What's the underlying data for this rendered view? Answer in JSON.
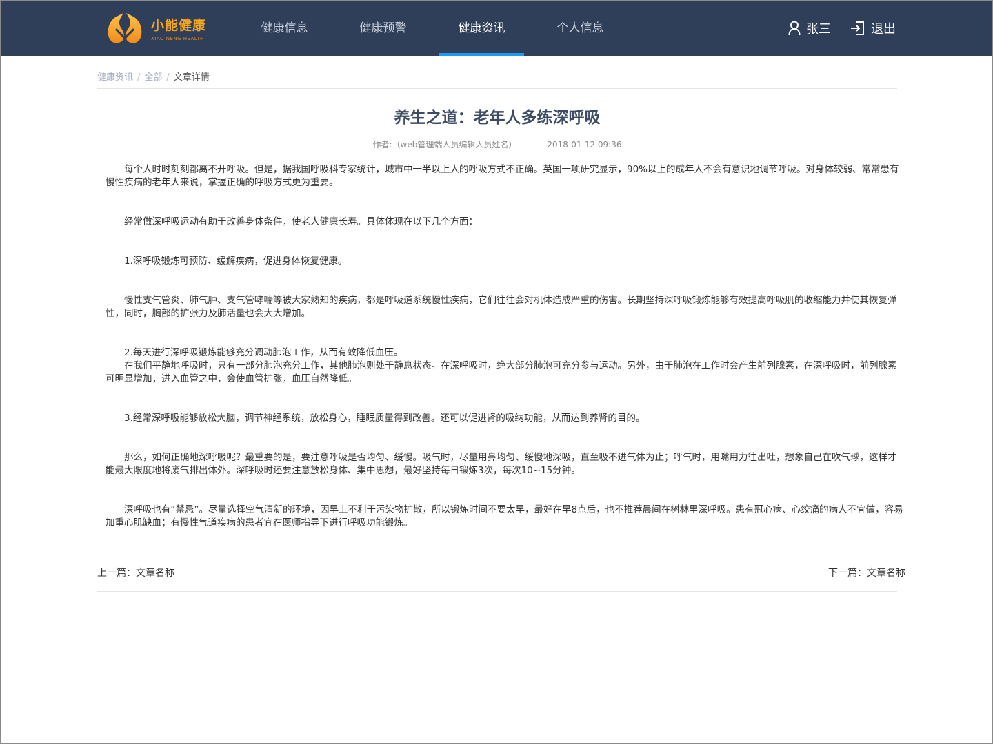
{
  "brand": {
    "name": "小能健康",
    "subtitle": "XIAO NENG HEALTH",
    "logo_icon": "lungs-logo-icon",
    "color": "#f5a623"
  },
  "header": {
    "background": "#2f3f59",
    "nav": [
      {
        "label": "健康信息",
        "active": false
      },
      {
        "label": "健康预警",
        "active": false
      },
      {
        "label": "健康资讯",
        "active": true
      },
      {
        "label": "个人信息",
        "active": false
      }
    ],
    "active_indicator_color": "#1e9bf0",
    "user": {
      "icon": "user-icon",
      "name": "张三"
    },
    "logout": {
      "icon": "logout-icon",
      "label": "退出"
    }
  },
  "breadcrumb": {
    "items": [
      "健康资讯",
      "全部"
    ],
    "current": "文章详情",
    "separator": "/"
  },
  "article": {
    "title": "养生之道：老年人多练深呼吸",
    "author": "作者:（web管理端人员编辑人员姓名）",
    "date": "2018-01-12 09:36",
    "paragraphs": [
      "每个人时时刻刻都离不开呼吸。但是，据我国呼吸科专家统计，城市中一半以上人的呼吸方式不正确。英国一项研究显示，90%以上的成年人不会有意识地调节呼吸。对身体较弱、常常患有慢性疾病的老年人来说，掌握正确的呼吸方式更为重要。",
      "经常做深呼吸运动有助于改善身体条件，使老人健康长寿。具体体现在以下几个方面：",
      "1.深呼吸锻炼可预防、缓解疾病，促进身体恢复健康。",
      "慢性支气管炎、肺气肿、支气管哮喘等被大家熟知的疾病，都是呼吸道系统慢性疾病，它们往往会对机体造成严重的伤害。长期坚持深呼吸锻炼能够有效提高呼吸肌的收缩能力并使其恢复弹性，同时，胸部的扩张力及肺活量也会大大增加。",
      "2.每天进行深呼吸锻炼能够充分调动肺泡工作，从而有效降低血压。",
      "在我们平静地呼吸时，只有一部分肺泡充分工作，其他肺泡则处于静息状态。在深呼吸时，绝大部分肺泡可充分参与运动。另外，由于肺泡在工作时会产生前列腺素，在深呼吸时，前列腺素可明显增加，进入血管之中，会使血管扩张，血压自然降低。",
      "3.经常深呼吸能够放松大脑，调节神经系统，放松身心，睡眠质量得到改善。还可以促进肾的吸纳功能，从而达到养肾的目的。",
      "那么，如何正确地深呼吸呢？最重要的是，要注意呼吸是否均匀、缓慢。吸气时，尽量用鼻均匀、缓慢地深吸，直至吸不进气体为止；呼气时，用嘴用力往出吐，想象自己在吹气球，这样才能最大限度地将废气排出体外。深呼吸时还要注意放松身体、集中思想，最好坚持每日锻炼3次，每次10~15分钟。",
      "深呼吸也有“禁忌”。尽量选择空气清新的环境，因早上不利于污染物扩散，所以锻炼时间不要太早，最好在早8点后，也不推荐晨间在树林里深呼吸。患有冠心病、心绞痛的病人不宜做，容易加重心肌缺血；有慢性气道疾病的患者宜在医师指导下进行呼吸功能锻炼。"
    ]
  },
  "pager": {
    "prev": "上一篇：文章名称",
    "next": "下一篇：文章名称"
  }
}
